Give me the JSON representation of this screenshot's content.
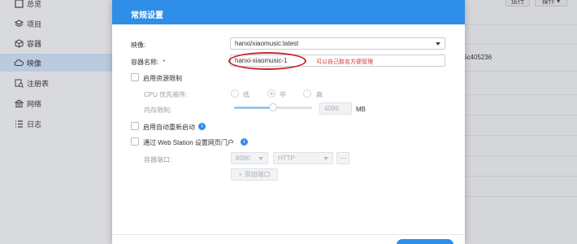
{
  "sidebar": {
    "items": [
      {
        "label": "总览",
        "icon": "dashboard-icon",
        "active": false
      },
      {
        "label": "项目",
        "icon": "project-icon",
        "active": false
      },
      {
        "label": "容器",
        "icon": "container-icon",
        "active": false
      },
      {
        "label": "映像",
        "icon": "cloud-icon",
        "active": true
      },
      {
        "label": "注册表",
        "icon": "registry-icon",
        "active": false
      },
      {
        "label": "网络",
        "icon": "network-icon",
        "active": false
      },
      {
        "label": "日志",
        "icon": "log-icon",
        "active": false
      }
    ]
  },
  "background": {
    "run_label": "运行",
    "action_label": "操作 ▾",
    "id_fragment": "5c405236"
  },
  "dialog": {
    "title": "常规设置",
    "image_label": "映像:",
    "image_value": "hanxi/xiaomusic:latest",
    "container_name_label": "容器名称:",
    "required_mark": "*",
    "container_name_value": "hanxi-xiaomusic-1",
    "annotation_hint": "可以自己取名方便管理",
    "resource_limit_label": "启用资源限制",
    "cpu_priority_label": "CPU 优先顺序:",
    "cpu_options": [
      "低",
      "中",
      "高"
    ],
    "cpu_selected": "中",
    "memory_label": "内存限制:",
    "memory_value": "4096",
    "memory_unit": "MB",
    "memory_fraction": 0.5,
    "auto_restart_label": "启用自动重新启动",
    "web_portal_label": "通过 Web Station 设置网页门户",
    "port_label": "容器端口:",
    "port_value": "8090",
    "protocol_value": "HTTP",
    "remove_port_label": "—",
    "add_port_label": "+ 添加端口"
  },
  "colors": {
    "header": "#2e8ee8",
    "annotation": "#c8232c",
    "hint_text": "#d9363e"
  }
}
